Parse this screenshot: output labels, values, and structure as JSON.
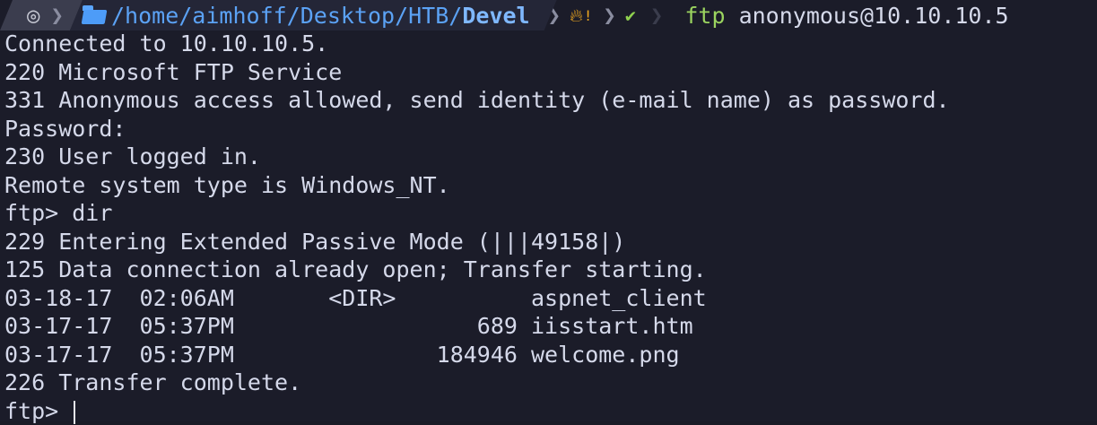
{
  "prompt": {
    "os_icon": "linux-distro-icon",
    "path_prefix": "/home/aimhoff/Desktop/HTB/",
    "path_last": "Devel",
    "fire_icon": "fire-icon",
    "check_icon": "checkmark-icon",
    "command": "ftp",
    "argument": "anonymous@10.10.10.5"
  },
  "output": [
    "Connected to 10.10.10.5.",
    "220 Microsoft FTP Service",
    "331 Anonymous access allowed, send identity (e-mail name) as password.",
    "Password:",
    "230 User logged in.",
    "Remote system type is Windows_NT.",
    "ftp> dir",
    "229 Entering Extended Passive Mode (|||49158|)",
    "125 Data connection already open; Transfer starting.",
    "03-18-17  02:06AM       <DIR>          aspnet_client",
    "03-17-17  05:37PM                  689 iisstart.htm",
    "03-17-17  05:37PM               184946 welcome.png",
    "226 Transfer complete."
  ],
  "ftp_prompt": "ftp> ",
  "colors": {
    "background": "#1b1c29",
    "path": "#5ba2f5",
    "command": "#9ad35f",
    "check": "#8fd14f",
    "fire": "#f0a91f"
  }
}
